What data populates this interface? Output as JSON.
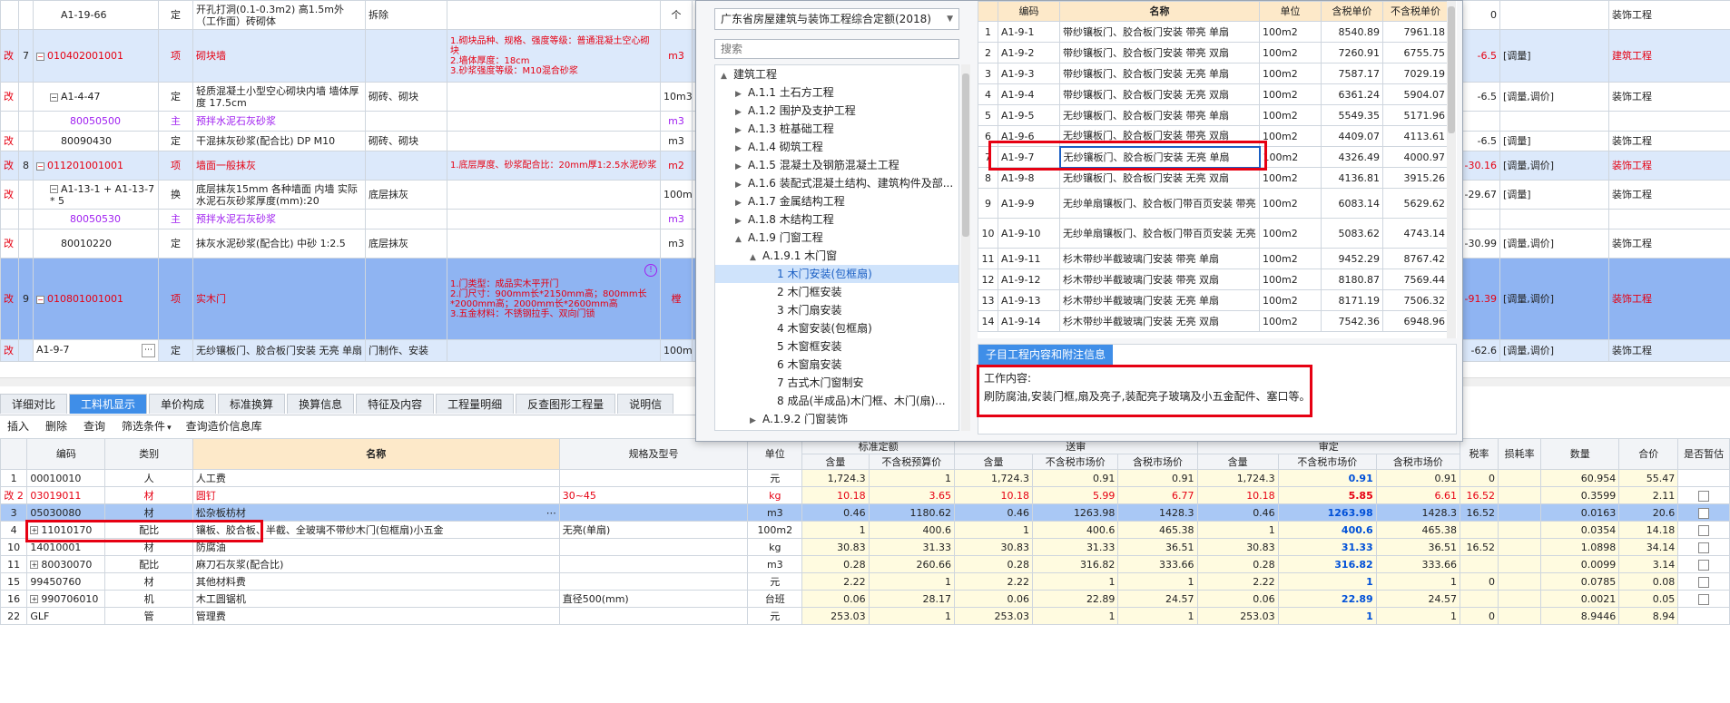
{
  "top_table": {
    "rows": [
      {
        "mark": "",
        "no": "",
        "code": "A1-19-66",
        "type": "定",
        "name": "开孔打洞(0.1-0.3m2) 高1.5m外（工作面）砖砌体",
        "feature": "拆除",
        "desc": "",
        "unit": "个",
        "qty": "0",
        "extra": "",
        "cat": "装饰工程"
      },
      {
        "mark": "改",
        "no": "7",
        "code": "010402001001",
        "type": "项",
        "name": "砌块墙",
        "feature": "",
        "desc": "1.砌块品种、规格、强度等级：普通混凝土空心砌块\n2.墙体厚度：18cm\n3.砂浆强度等级：M10混合砂浆",
        "unit": "m3",
        "qty": "-6.5",
        "extra": "[调量]",
        "cat": "建筑工程"
      },
      {
        "mark": "改",
        "no": "",
        "code": "A1-4-47",
        "type": "定",
        "name": "轻质混凝土小型空心砌块内墙 墙体厚度 17.5cm",
        "feature": "砌砖、砌块",
        "desc": "",
        "unit": "10m3",
        "qty": "-6.5",
        "extra": "[调量,调价]",
        "cat": "装饰工程"
      },
      {
        "mark": "",
        "no": "",
        "code": "80050500",
        "type": "主",
        "name": "预拌水泥石灰砂浆",
        "feature": "",
        "desc": "",
        "unit": "m3",
        "qty": "",
        "extra": "",
        "cat": ""
      },
      {
        "mark": "改",
        "no": "",
        "code": "80090430",
        "type": "定",
        "name": "干混抹灰砂浆(配合比) DP M10",
        "feature": "砌砖、砌块",
        "desc": "",
        "unit": "m3",
        "qty": "-6.5",
        "extra": "[调量]",
        "cat": "装饰工程"
      },
      {
        "mark": "改",
        "no": "8",
        "code": "011201001001",
        "type": "项",
        "name": "墙面一般抹灰",
        "feature": "",
        "desc": "1.底层厚度、砂浆配合比：20mm厚1:2.5水泥砂浆",
        "unit": "m2",
        "qty": "-30.16",
        "extra": "[调量,调价]",
        "cat": "装饰工程"
      },
      {
        "mark": "改",
        "no": "",
        "code": "A1-13-1 + A1-13-7 * 5",
        "type": "换",
        "name": "底层抹灰15mm 各种墙面 内墙 实际水泥石灰砂浆厚度(mm):20",
        "feature": "底层抹灰",
        "desc": "",
        "unit": "100m2",
        "qty": "-29.67",
        "extra": "[调量]",
        "cat": "装饰工程"
      },
      {
        "mark": "",
        "no": "",
        "code": "80050530",
        "type": "主",
        "name": "预拌水泥石灰砂浆",
        "feature": "",
        "desc": "",
        "unit": "m3",
        "qty": "",
        "extra": "",
        "cat": ""
      },
      {
        "mark": "改",
        "no": "",
        "code": "80010220",
        "type": "定",
        "name": "抹灰水泥砂浆(配合比) 中砂 1:2.5",
        "feature": "底层抹灰",
        "desc": "",
        "unit": "m3",
        "qty": "-30.99",
        "extra": "[调量,调价]",
        "cat": "装饰工程"
      },
      {
        "mark": "改",
        "no": "9",
        "code": "010801001001",
        "type": "项",
        "name": "实木门",
        "feature": "",
        "desc": "1.门类型：成品实木平开门\n2.门尺寸：900mm长*2150mm高；800mm长*2000mm高；2000mm长*2600mm高\n3.五金材料：不锈钢拉手、双向门锁",
        "unit": "樘",
        "qty": "-91.39",
        "extra": "[调量,调价]",
        "cat": "装饰工程"
      },
      {
        "mark": "改",
        "no": "",
        "code": "A1-9-7",
        "type": "定",
        "name": "无纱镶板门、胶合板门安装 无亮 单扇",
        "feature": "门制作、安装",
        "desc": "",
        "unit": "100m2",
        "qty": "-62.6",
        "extra": "[调量,调价]",
        "cat": "装饰工程"
      }
    ]
  },
  "mid_tabs": [
    "详细对比",
    "工料机显示",
    "单价构成",
    "标准换算",
    "换算信息",
    "特征及内容",
    "工程量明细",
    "反查图形工程量",
    "说明信"
  ],
  "toolbar": [
    "插入",
    "删除",
    "查询",
    "筛选条件",
    "查询造价信息库"
  ],
  "bottom": {
    "group_headers": [
      "标准定额",
      "送审",
      "审定"
    ],
    "cols": [
      "编码",
      "类别",
      "名称",
      "规格及型号",
      "单位",
      "含量",
      "不含税预算价",
      "含量",
      "不含税市场价",
      "含税市场价",
      "含量",
      "不含税市场价",
      "含税市场价",
      "税率",
      "损耗率",
      "数量",
      "合价",
      "是否暂估"
    ],
    "rows": [
      {
        "no": "1",
        "code": "00010010",
        "plus": false,
        "type": "人",
        "name": "人工费",
        "spec": "",
        "unit": "元",
        "c1": "1,724.3",
        "p1": "1",
        "c2": "1,724.3",
        "p2": "0.91",
        "p3": "0.91",
        "c3": "1,724.3",
        "p4": "0.91",
        "p5": "0.91",
        "tax": "0",
        "loss": "",
        "qty": "60.954",
        "total": "55.47",
        "cb": false
      },
      {
        "no": "改 2",
        "code": "03019011",
        "plus": false,
        "type": "材",
        "name": "圆钉",
        "spec": "30~45",
        "unit": "kg",
        "c1": "10.18",
        "p1": "3.65",
        "c2": "10.18",
        "p2": "5.99",
        "p3": "6.77",
        "c3": "10.18",
        "p4": "5.85",
        "p5": "6.61",
        "tax": "16.52",
        "loss": "",
        "qty": "0.3599",
        "total": "2.11",
        "cb": true
      },
      {
        "no": "3",
        "code": "05030080",
        "plus": false,
        "type": "材",
        "name": "松杂板枋材",
        "spec": "",
        "unit": "m3",
        "c1": "0.46",
        "p1": "1180.62",
        "c2": "0.46",
        "p2": "1263.98",
        "p3": "1428.3",
        "c3": "0.46",
        "p4": "1263.98",
        "p5": "1428.3",
        "tax": "16.52",
        "loss": "",
        "qty": "0.0163",
        "total": "20.6",
        "cb": true
      },
      {
        "no": "4",
        "code": "11010170",
        "plus": true,
        "type": "配比",
        "name": "镶板、胶合板、半截、全玻璃不带纱木门(包框扇)小五金",
        "spec": "无亮(单扇)",
        "unit": "100m2",
        "c1": "1",
        "p1": "400.6",
        "c2": "1",
        "p2": "400.6",
        "p3": "465.38",
        "c3": "1",
        "p4": "400.6",
        "p5": "465.38",
        "tax": "",
        "loss": "",
        "qty": "0.0354",
        "total": "14.18",
        "cb": true
      },
      {
        "no": "10",
        "code": "14010001",
        "plus": false,
        "type": "材",
        "name": "防腐油",
        "spec": "",
        "unit": "kg",
        "c1": "30.83",
        "p1": "31.33",
        "c2": "30.83",
        "p2": "31.33",
        "p3": "36.51",
        "c3": "30.83",
        "p4": "31.33",
        "p5": "36.51",
        "tax": "16.52",
        "loss": "",
        "qty": "1.0898",
        "total": "34.14",
        "cb": true
      },
      {
        "no": "11",
        "code": "80030070",
        "plus": true,
        "type": "配比",
        "name": "麻刀石灰浆(配合比)",
        "spec": "",
        "unit": "m3",
        "c1": "0.28",
        "p1": "260.66",
        "c2": "0.28",
        "p2": "316.82",
        "p3": "333.66",
        "c3": "0.28",
        "p4": "316.82",
        "p5": "333.66",
        "tax": "",
        "loss": "",
        "qty": "0.0099",
        "total": "3.14",
        "cb": true
      },
      {
        "no": "15",
        "code": "99450760",
        "plus": false,
        "type": "材",
        "name": "其他材料费",
        "spec": "",
        "unit": "元",
        "c1": "2.22",
        "p1": "1",
        "c2": "2.22",
        "p2": "1",
        "p3": "1",
        "c3": "2.22",
        "p4": "1",
        "p5": "1",
        "tax": "0",
        "loss": "",
        "qty": "0.0785",
        "total": "0.08",
        "cb": true
      },
      {
        "no": "16",
        "code": "990706010",
        "plus": true,
        "type": "机",
        "name": "木工圆锯机",
        "spec": "直径500(mm)",
        "unit": "台班",
        "c1": "0.06",
        "p1": "28.17",
        "c2": "0.06",
        "p2": "22.89",
        "p3": "24.57",
        "c3": "0.06",
        "p4": "22.89",
        "p5": "24.57",
        "tax": "",
        "loss": "",
        "qty": "0.0021",
        "total": "0.05",
        "cb": true
      },
      {
        "no": "22",
        "code": "GLF",
        "plus": false,
        "type": "管",
        "name": "管理费",
        "spec": "",
        "unit": "元",
        "c1": "253.03",
        "p1": "1",
        "c2": "253.03",
        "p2": "1",
        "p3": "1",
        "c3": "253.03",
        "p4": "1",
        "p5": "1",
        "tax": "0",
        "loss": "",
        "qty": "8.9446",
        "total": "8.94",
        "cb": false
      }
    ]
  },
  "popup": {
    "quota_select": "广东省房屋建筑与装饰工程综合定额(2018)",
    "search_placeholder": "搜索",
    "tree": [
      {
        "lvl": 0,
        "arrow": "▲",
        "label": "建筑工程"
      },
      {
        "lvl": 1,
        "arrow": "▶",
        "label": "A.1.1 土石方工程"
      },
      {
        "lvl": 1,
        "arrow": "▶",
        "label": "A.1.2 围护及支护工程"
      },
      {
        "lvl": 1,
        "arrow": "▶",
        "label": "A.1.3 桩基础工程"
      },
      {
        "lvl": 1,
        "arrow": "▶",
        "label": "A.1.4 砌筑工程"
      },
      {
        "lvl": 1,
        "arrow": "▶",
        "label": "A.1.5 混凝土及钢筋混凝土工程"
      },
      {
        "lvl": 1,
        "arrow": "▶",
        "label": "A.1.6 装配式混凝土结构、建筑构件及部..."
      },
      {
        "lvl": 1,
        "arrow": "▶",
        "label": "A.1.7 金属结构工程"
      },
      {
        "lvl": 1,
        "arrow": "▶",
        "label": "A.1.8 木结构工程"
      },
      {
        "lvl": 1,
        "arrow": "▲",
        "label": "A.1.9 门窗工程"
      },
      {
        "lvl": 2,
        "arrow": "▲",
        "label": "A.1.9.1 木门窗"
      },
      {
        "lvl": 3,
        "arrow": "",
        "label": "1 木门安装(包框扇)",
        "sel": true
      },
      {
        "lvl": 3,
        "arrow": "",
        "label": "2 木门框安装"
      },
      {
        "lvl": 3,
        "arrow": "",
        "label": "3 木门扇安装"
      },
      {
        "lvl": 3,
        "arrow": "",
        "label": "4 木窗安装(包框扇)"
      },
      {
        "lvl": 3,
        "arrow": "",
        "label": "5 木窗框安装"
      },
      {
        "lvl": 3,
        "arrow": "",
        "label": "6 木窗扇安装"
      },
      {
        "lvl": 3,
        "arrow": "",
        "label": "7 古式木门窗制安"
      },
      {
        "lvl": 3,
        "arrow": "",
        "label": "8 成品(半成品)木门框、木门(扇)..."
      },
      {
        "lvl": 2,
        "arrow": "▶",
        "label": "A.1.9.2 门窗装饰"
      }
    ],
    "list_headers": [
      "编码",
      "名称",
      "单位",
      "含税单价",
      "不含税单价"
    ],
    "list": [
      {
        "no": "1",
        "code": "A1-9-1",
        "name": "带纱镶板门、胶合板门安装 带亮 单扇",
        "unit": "100m2",
        "tax": "8540.89",
        "notax": "7961.18"
      },
      {
        "no": "2",
        "code": "A1-9-2",
        "name": "带纱镶板门、胶合板门安装 带亮 双扇",
        "unit": "100m2",
        "tax": "7260.91",
        "notax": "6755.75"
      },
      {
        "no": "3",
        "code": "A1-9-3",
        "name": "带纱镶板门、胶合板门安装 无亮 单扇",
        "unit": "100m2",
        "tax": "7587.17",
        "notax": "7029.19"
      },
      {
        "no": "4",
        "code": "A1-9-4",
        "name": "带纱镶板门、胶合板门安装 无亮 双扇",
        "unit": "100m2",
        "tax": "6361.24",
        "notax": "5904.07"
      },
      {
        "no": "5",
        "code": "A1-9-5",
        "name": "无纱镶板门、胶合板门安装 带亮 单扇",
        "unit": "100m2",
        "tax": "5549.35",
        "notax": "5171.96"
      },
      {
        "no": "6",
        "code": "A1-9-6",
        "name": "无纱镶板门、胶合板门安装 带亮 双扇",
        "unit": "100m2",
        "tax": "4409.07",
        "notax": "4113.61"
      },
      {
        "no": "7",
        "code": "A1-9-7",
        "name": "无纱镶板门、胶合板门安装 无亮 单扇",
        "unit": "100m2",
        "tax": "4326.49",
        "notax": "4000.97"
      },
      {
        "no": "8",
        "code": "A1-9-8",
        "name": "无纱镶板门、胶合板门安装 无亮 双扇",
        "unit": "100m2",
        "tax": "4136.81",
        "notax": "3915.26"
      },
      {
        "no": "9",
        "code": "A1-9-9",
        "name": "无纱单扇镶板门、胶合板门带百页安装 带亮",
        "unit": "100m2",
        "tax": "6083.14",
        "notax": "5629.62"
      },
      {
        "no": "10",
        "code": "A1-9-10",
        "name": "无纱单扇镶板门、胶合板门带百页安装 无亮",
        "unit": "100m2",
        "tax": "5083.62",
        "notax": "4743.14"
      },
      {
        "no": "11",
        "code": "A1-9-11",
        "name": "杉木带纱半截玻璃门安装 带亮 单扇",
        "unit": "100m2",
        "tax": "9452.29",
        "notax": "8767.42"
      },
      {
        "no": "12",
        "code": "A1-9-12",
        "name": "杉木带纱半截玻璃门安装 带亮 双扇",
        "unit": "100m2",
        "tax": "8180.87",
        "notax": "7569.44"
      },
      {
        "no": "13",
        "code": "A1-9-13",
        "name": "杉木带纱半截玻璃门安装 无亮 单扇",
        "unit": "100m2",
        "tax": "8171.19",
        "notax": "7506.32"
      },
      {
        "no": "14",
        "code": "A1-9-14",
        "name": "杉木带纱半截玻璃门安装 无亮 双扇",
        "unit": "100m2",
        "tax": "7542.36",
        "notax": "6948.96"
      }
    ],
    "info_tab": "子目工程内容和附注信息",
    "info_title": "工作内容:",
    "info_text": "刷防腐油,安装门框,扇及亮子,装配亮子玻璃及小五金配件、塞口等。"
  },
  "colors": {
    "blue_row": "#8fb4f2",
    "light_row": "#dce9fb",
    "accent": "#3f8ee8",
    "highlight": "#e60012"
  }
}
